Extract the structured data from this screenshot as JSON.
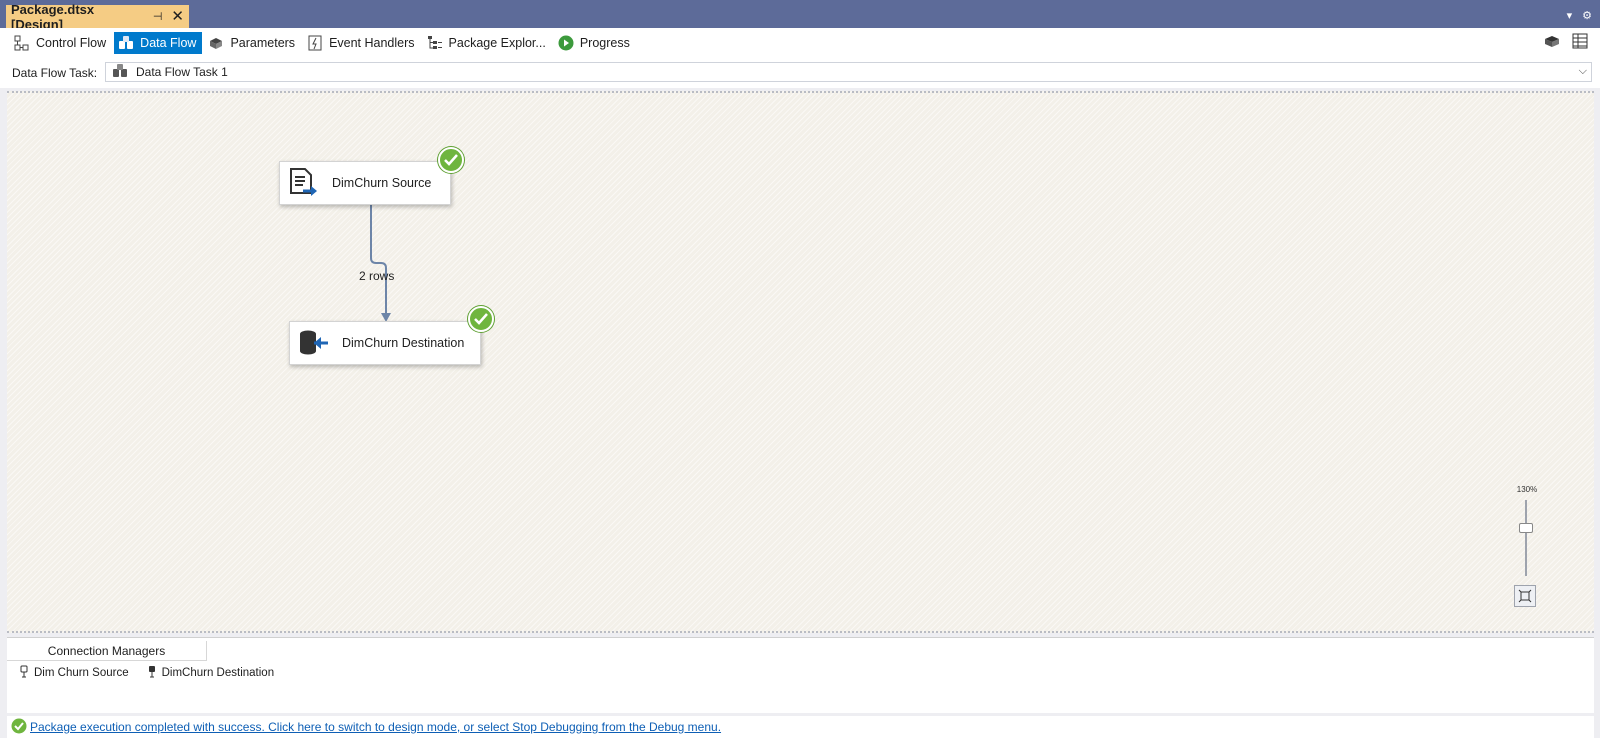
{
  "document_tab": {
    "title": "Package.dtsx [Design]",
    "pin_glyph": "⊣",
    "close_glyph": "✕"
  },
  "designer_tabs": [
    {
      "label": "Control Flow",
      "icon": "control-flow-icon",
      "active": false
    },
    {
      "label": "Data Flow",
      "icon": "data-flow-icon",
      "active": true
    },
    {
      "label": "Parameters",
      "icon": "parameters-icon",
      "active": false
    },
    {
      "label": "Event Handlers",
      "icon": "event-handlers-icon",
      "active": false
    },
    {
      "label": "Package Explor...",
      "icon": "package-explorer-icon",
      "active": false
    },
    {
      "label": "Progress",
      "icon": "progress-icon",
      "active": false
    }
  ],
  "task_selector": {
    "label": "Data Flow Task:",
    "value": "Data Flow Task 1"
  },
  "canvas": {
    "source_node": {
      "label": "DimChurn Source",
      "icon": "flat-file-source-icon",
      "status": "success"
    },
    "destination_node": {
      "label": "DimChurn Destination",
      "icon": "ole-db-destination-icon",
      "status": "success"
    },
    "path_label": "2 rows",
    "zoom_label": "130%"
  },
  "connection_managers": {
    "tab_label": "Connection Managers",
    "items": [
      {
        "label": "Dim Churn Source",
        "icon": "connection-icon"
      },
      {
        "label": "DimChurn Destination",
        "icon": "connection-icon"
      }
    ]
  },
  "status": {
    "message": "Package execution completed with success. Click here to switch to design mode, or select Stop Debugging from the Debug menu."
  },
  "colors": {
    "accent": "#007acc",
    "title_bar": "#5d6b99",
    "doc_tab": "#f5cc84",
    "success": "#6fb53e",
    "link": "#0e5fb5"
  }
}
